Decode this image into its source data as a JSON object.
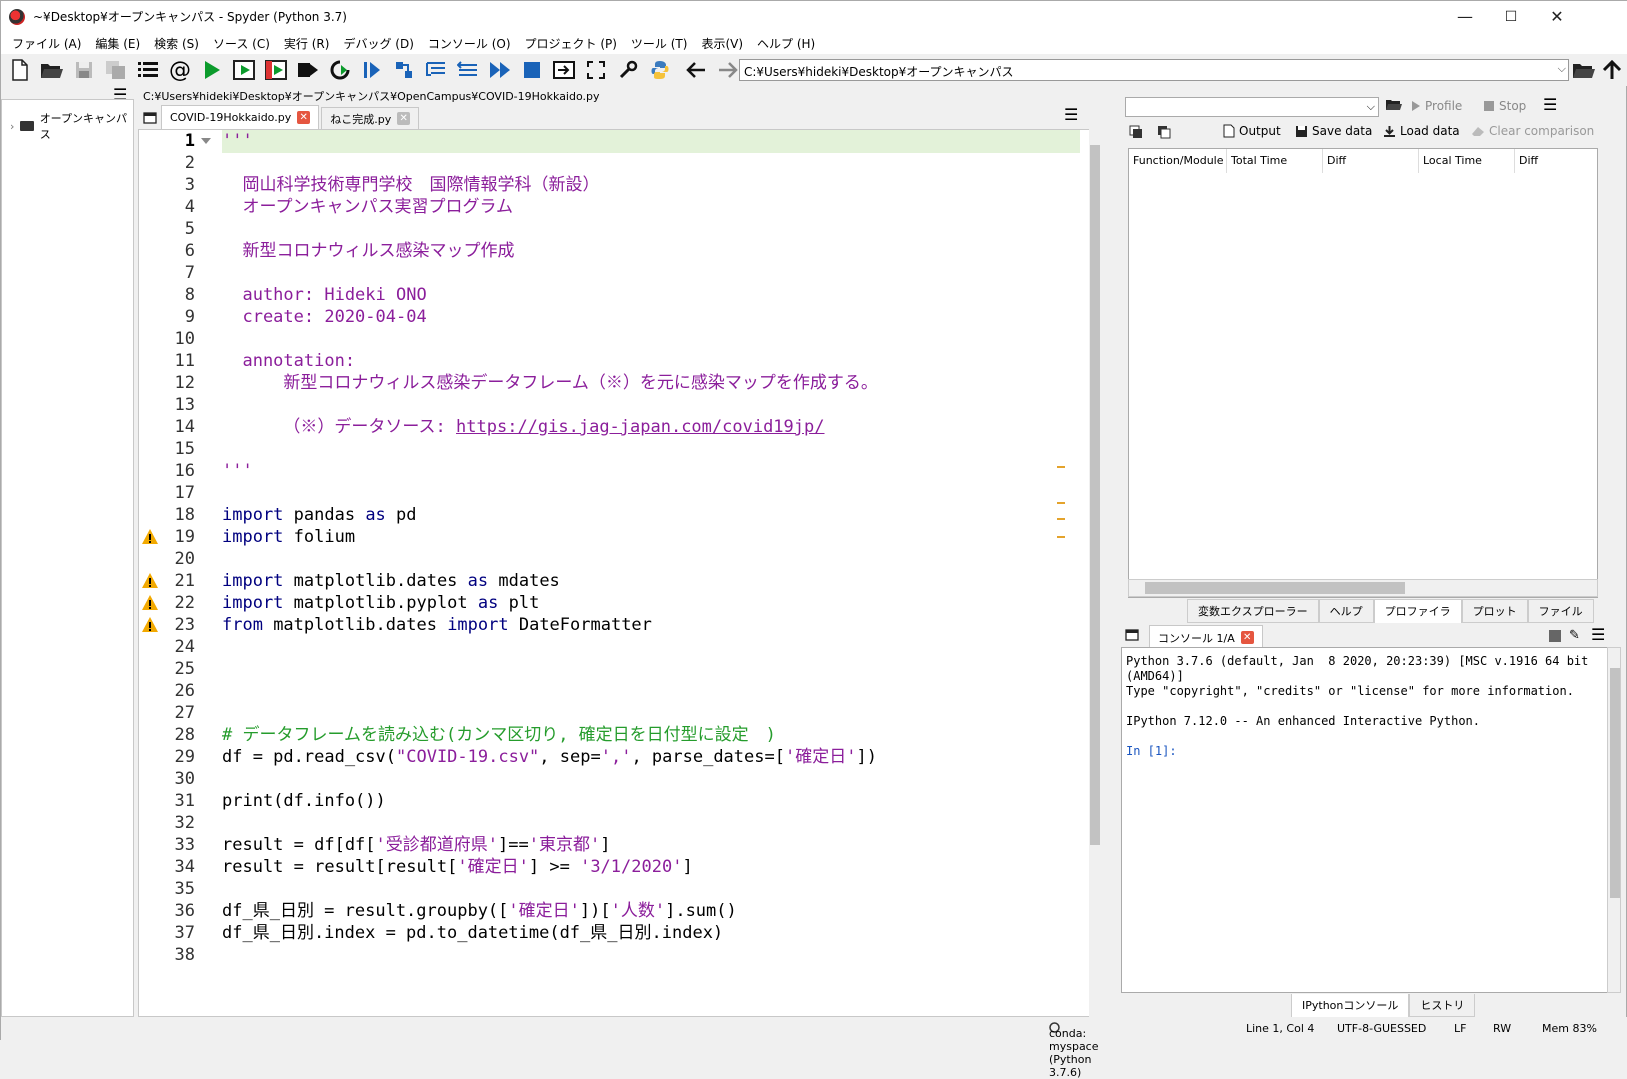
{
  "window": {
    "title": "~¥Desktop¥オープンキャンパス - Spyder (Python 3.7)",
    "minimize": "—",
    "maximize": "☐",
    "close": "✕"
  },
  "menu": [
    "ファイル (A)",
    "編集 (E)",
    "検索 (S)",
    "ソース (C)",
    "実行 (R)",
    "デバッグ (D)",
    "コンソール (O)",
    "プロジェクト (P)",
    "ツール (T)",
    "表示(V)",
    "ヘルプ (H)"
  ],
  "toolbar": {
    "working_dir": "C:¥Users¥hideki¥Desktop¥オープンキャンパス"
  },
  "editor": {
    "file_path": "C:¥Users¥hideki¥Desktop¥オープンキャンパス¥OpenCampus¥COVID-19Hokkaido.py",
    "tabs": [
      {
        "label": "COVID-19Hokkaido.py",
        "active": true
      },
      {
        "label": "ねこ完成.py",
        "active": false
      }
    ],
    "warning_lines": [
      19,
      21,
      22,
      23
    ],
    "lines": [
      {
        "n": "1",
        "text": "'''"
      },
      {
        "n": "2",
        "text": ""
      },
      {
        "n": "3",
        "text": "  岡山科学技術専門学校　国際情報学科（新設）"
      },
      {
        "n": "4",
        "text": "  オープンキャンパス実習プログラム"
      },
      {
        "n": "5",
        "text": ""
      },
      {
        "n": "6",
        "text": "  新型コロナウィルス感染マップ作成"
      },
      {
        "n": "7",
        "text": ""
      },
      {
        "n": "8",
        "text": "  author: Hideki ONO"
      },
      {
        "n": "9",
        "text": "  create: 2020-04-04"
      },
      {
        "n": "10",
        "text": ""
      },
      {
        "n": "11",
        "text": "  annotation:"
      },
      {
        "n": "12",
        "text": "      新型コロナウィルス感染データフレーム（※）を元に感染マップを作成する。"
      },
      {
        "n": "13",
        "text": ""
      },
      {
        "n": "14",
        "text": "      （※）データソース: "
      },
      {
        "n": "15",
        "text": ""
      },
      {
        "n": "16",
        "text": "'''"
      },
      {
        "n": "17",
        "text": ""
      },
      {
        "n": "18",
        "text": ""
      },
      {
        "n": "19",
        "text": ""
      },
      {
        "n": "20",
        "text": ""
      },
      {
        "n": "21",
        "text": ""
      },
      {
        "n": "22",
        "text": ""
      },
      {
        "n": "23",
        "text": ""
      },
      {
        "n": "24",
        "text": ""
      },
      {
        "n": "25",
        "text": ""
      },
      {
        "n": "26",
        "text": ""
      },
      {
        "n": "27",
        "text": ""
      },
      {
        "n": "28",
        "text": "# データフレームを読み込む(カンマ区切り, 確定日を日付型に設定　)"
      },
      {
        "n": "29",
        "text": ""
      },
      {
        "n": "30",
        "text": ""
      },
      {
        "n": "31",
        "text": "print(df.info())"
      },
      {
        "n": "32",
        "text": ""
      },
      {
        "n": "33",
        "text": ""
      },
      {
        "n": "34",
        "text": ""
      },
      {
        "n": "35",
        "text": ""
      },
      {
        "n": "36",
        "text": ""
      },
      {
        "n": "37",
        "text": "df_県_日別.index = pd.to_datetime(df_県_日別.index)"
      },
      {
        "n": "38",
        "text": ""
      }
    ],
    "tokens": {
      "url": "https://gis.jag-japan.com/covid19jp/",
      "l18_kw1": "import",
      "l18_mid": " pandas ",
      "l18_kw2": "as",
      "l18_end": " pd",
      "l19_kw1": "import",
      "l19_end": " folium",
      "l21_kw1": "import",
      "l21_mid": " matplotlib.dates ",
      "l21_kw2": "as",
      "l21_end": " mdates",
      "l22_kw1": "import",
      "l22_mid": " matplotlib.pyplot ",
      "l22_kw2": "as",
      "l22_end": " plt",
      "l23_kw1": "from",
      "l23_mid": " matplotlib.dates ",
      "l23_kw2": "import",
      "l23_end": " DateFormatter",
      "l29_a": "df = pd.read_csv(",
      "l29_s1": "\"COVID-19.csv\"",
      "l29_b": ", sep=",
      "l29_s2": "','",
      "l29_c": ", parse_dates=[",
      "l29_s3": "'確定日'",
      "l29_d": "])",
      "l33_a": "result = df[df[",
      "l33_s1": "'受診都道府県'",
      "l33_b": "]==",
      "l33_s2": "'東京都'",
      "l33_c": "]",
      "l34_a": "result = result[result[",
      "l34_s1": "'確定日'",
      "l34_b": "] >= ",
      "l34_s2": "'3/1/2020'",
      "l34_c": "]",
      "l36_a": "df_県_日別 = result.groupby([",
      "l36_s1": "'確定日'",
      "l36_b": "])[",
      "l36_s2": "'人数'",
      "l36_c": "].sum()"
    }
  },
  "file_tree": {
    "root": "オープンキャンパス"
  },
  "profiler": {
    "combo_value": "",
    "profile_label": "Profile",
    "stop_label": "Stop",
    "output_label": "Output",
    "save_label": "Save data",
    "load_label": "Load data",
    "clear_label": "Clear comparison",
    "columns": [
      "Function/Module",
      "Total Time",
      "Diff",
      "Local Time",
      "Diff"
    ]
  },
  "pane_tabs": [
    {
      "label": "変数エクスプローラー",
      "active": false
    },
    {
      "label": "ヘルプ",
      "active": false
    },
    {
      "label": "プロファイラ",
      "active": true
    },
    {
      "label": "プロット",
      "active": false
    },
    {
      "label": "ファイル",
      "active": false
    }
  ],
  "console": {
    "tab_label": "コンソール 1/A",
    "lines": [
      "Python 3.7.6 (default, Jan  8 2020, 20:23:39) [MSC v.1916 64 bit",
      "(AMD64)]",
      "Type \"copyright\", \"credits\" or \"license\" for more information.",
      "",
      "IPython 7.12.0 -- An enhanced Interactive Python.",
      "",
      "In [1]:"
    ],
    "bottom_tabs": [
      {
        "label": "IPythonコンソール",
        "active": true
      },
      {
        "label": "ヒストリ",
        "active": false
      }
    ]
  },
  "status": {
    "env": "conda: myspace (Python 3.7.6)",
    "position": "Line 1, Col 4",
    "encoding": "UTF-8-GUESSED",
    "eol": "LF",
    "mode": "RW",
    "mem": "Mem 83%"
  },
  "colors": {
    "string": "#8b1e9b",
    "keyword": "#00007f",
    "comment": "#259c2c",
    "current_line": "#e3f2d9",
    "tab_close": "#e55640",
    "warning": "#f2a900"
  }
}
